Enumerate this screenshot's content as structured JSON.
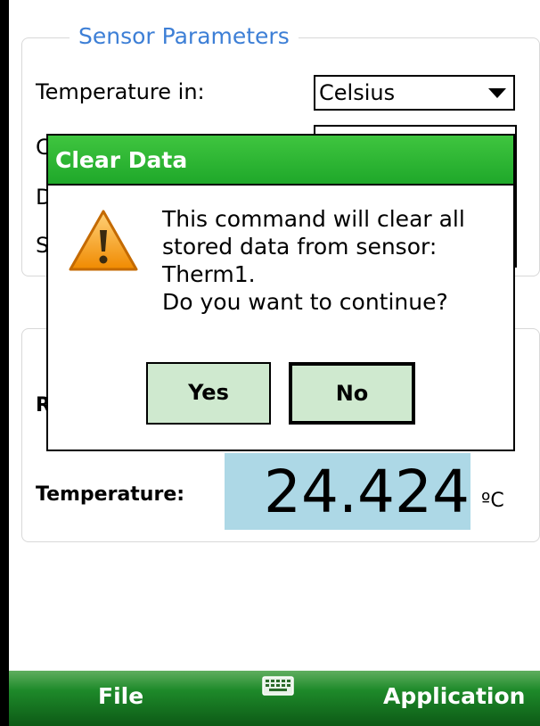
{
  "sensor_parameters": {
    "legend": "Sensor Parameters",
    "temperature_label": "Temperature in:",
    "temperature_unit_select": "Celsius",
    "hidden_label_initials": [
      "C",
      "D",
      "S"
    ]
  },
  "readings": {
    "hidden_label_initial": "R",
    "temperature_label": "Temperature:",
    "temperature_value": "24.424",
    "temperature_unit": "ºC"
  },
  "dialog": {
    "title": "Clear Data",
    "icon": "warning-icon",
    "message_lines": [
      "This command will clear all",
      "stored data from sensor:",
      "Therm1.",
      "Do you want to continue?"
    ],
    "yes_label": "Yes",
    "no_label": "No"
  },
  "softkeys": {
    "left": "File",
    "center_icon": "keyboard-icon",
    "right": "Application"
  },
  "colors": {
    "title_bar": "#1fa82a",
    "button_fill": "#cfe9cf",
    "temperature_highlight": "#add8e6",
    "legend_text": "#3d7fd6"
  }
}
